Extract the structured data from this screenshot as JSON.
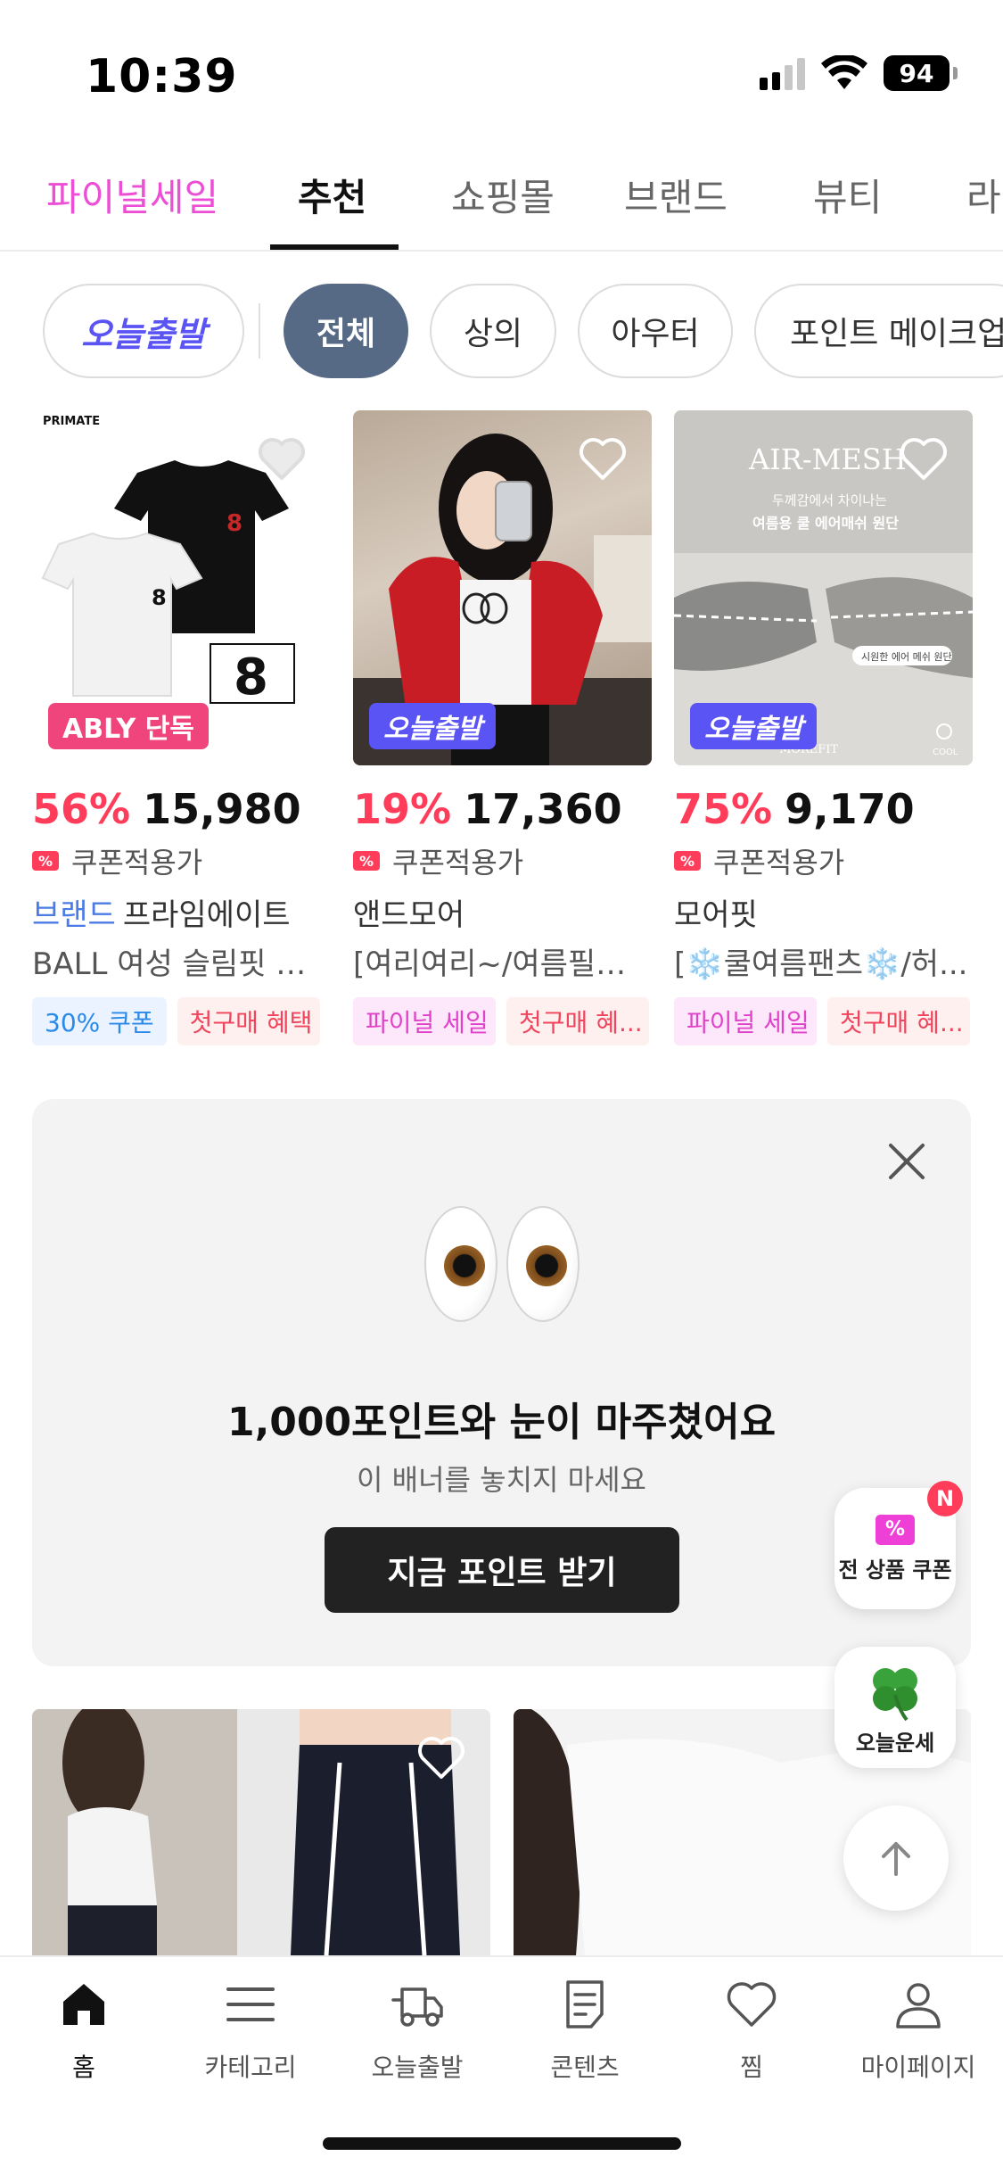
{
  "status_bar": {
    "time": "10:39",
    "battery": "94"
  },
  "top_tabs": [
    {
      "label": "파이널세일"
    },
    {
      "label": "추천"
    },
    {
      "label": "쇼핑몰"
    },
    {
      "label": "브랜드"
    },
    {
      "label": "뷰티"
    },
    {
      "label": "라"
    }
  ],
  "chips": {
    "today": "오늘출발",
    "items": [
      "전체",
      "상의",
      "아우터",
      "포인트 메이크업"
    ]
  },
  "products": [
    {
      "badge": "ABLY 단독",
      "discount": "56%",
      "price": "15,980",
      "coupon_text": "쿠폰적용가",
      "brand_tag": "브랜드",
      "brand": "프라임에이트",
      "title": "BALL 여성 슬림핏 반...",
      "tags": [
        "30% 쿠폰",
        "첫구매 혜택"
      ],
      "image_text": [
        "PRIMATE",
        "8"
      ]
    },
    {
      "badge": "오늘출발",
      "discount": "19%",
      "price": "17,360",
      "coupon_text": "쿠폰적용가",
      "brand": "앤드모어",
      "title": "[여리여리~/여름필수...",
      "tags": [
        "파이널 세일",
        "첫구매 혜..."
      ]
    },
    {
      "badge": "오늘출발",
      "discount": "75%",
      "price": "9,170",
      "coupon_text": "쿠폰적용가",
      "brand": "모어핏",
      "title": "[❄️쿨여름팬츠❄️/허...",
      "tags": [
        "파이널 세일",
        "첫구매 혜..."
      ],
      "image_text": [
        "AIR-MESH",
        "두께감에서 차이나는",
        "여름용 쿨 에어매쉬 원단",
        "시원한 에어 메쉬 원단",
        "MOREFIT",
        "COOL"
      ]
    }
  ],
  "banner": {
    "title": "1,000포인트와 눈이 마주쳤어요",
    "subtitle": "이 배너를 놓치지 마세요",
    "button": "지금 포인트 받기"
  },
  "floating": {
    "coupon_label": "전 상품 쿠폰",
    "coupon_badge": "N",
    "fortune_label": "오늘운세"
  },
  "bottom_nav": [
    {
      "label": "홈",
      "icon": "home-icon"
    },
    {
      "label": "카테고리",
      "icon": "menu-icon"
    },
    {
      "label": "오늘출발",
      "icon": "truck-icon"
    },
    {
      "label": "콘텐츠",
      "icon": "document-icon"
    },
    {
      "label": "찜",
      "icon": "heart-icon"
    },
    {
      "label": "마이페이지",
      "icon": "person-icon"
    }
  ],
  "colors": {
    "accent_pink": "#ec4fd5",
    "discount_red": "#ff3d5a",
    "today_purple": "#5b54f5",
    "chip_active": "#566a86"
  }
}
